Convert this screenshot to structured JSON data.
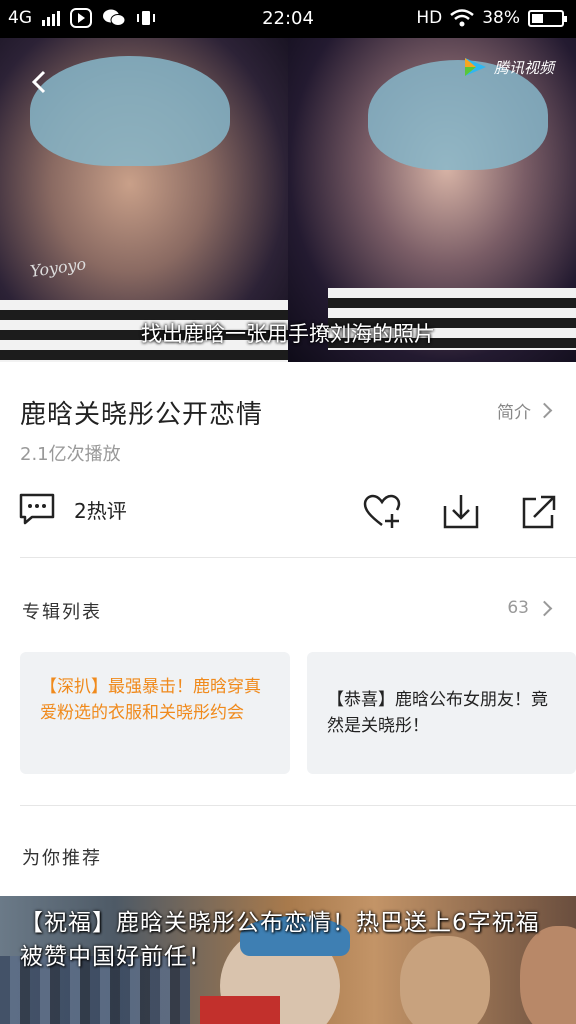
{
  "status_bar": {
    "network": "4G",
    "time": "22:04",
    "hd": "HD",
    "battery": "38%",
    "battery_level": 0.38
  },
  "video": {
    "logo_text": "腾讯视频",
    "watermark": "Yoyoyo",
    "subtitle": "找出鹿晗一张用手撩刘海的照片"
  },
  "info": {
    "title": "鹿晗关晓彤公开恋情",
    "intro_label": "简介",
    "play_count": "2.1亿次播放",
    "comment_label": "2热评"
  },
  "album": {
    "title": "专辑列表",
    "count": "63",
    "items": [
      {
        "text": "【深扒】最强暴击！鹿晗穿真爱粉选的衣服和关晓彤约会",
        "color": "#f08a1c"
      },
      {
        "text": "【恭喜】鹿晗公布女朋友！竟然是关晓彤！",
        "color": "#222222"
      }
    ]
  },
  "recommend": {
    "title": "为你推荐",
    "first_caption": "【祝福】鹿晗关晓彤公布恋情！热巴送上6字祝福被赞中国好前任！"
  },
  "icons": {
    "back": "back-arrow-icon",
    "comment": "comment-icon",
    "favorite": "heart-plus-icon",
    "download": "download-icon",
    "share": "share-icon"
  }
}
